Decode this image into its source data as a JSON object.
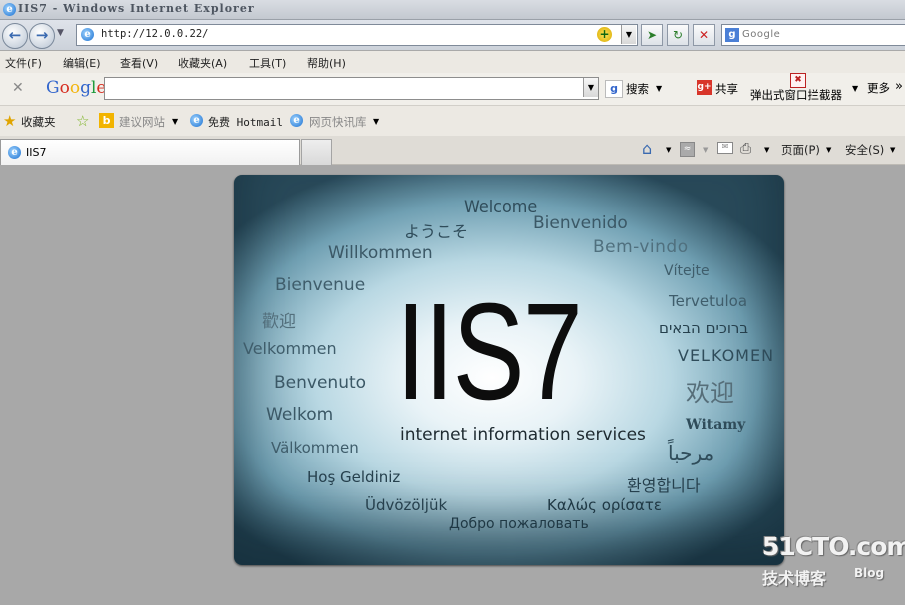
{
  "window": {
    "title": "IIS7 - Windows Internet Explorer"
  },
  "navbar": {
    "address": "http://12.0.0.22/",
    "search_placeholder": "Google"
  },
  "menu": {
    "items": [
      "文件(F)",
      "编辑(E)",
      "查看(V)",
      "收藏夹(A)",
      "工具(T)",
      "帮助(H)"
    ]
  },
  "google_toolbar": {
    "logo_text": "Google",
    "search_label": "搜索",
    "share_label": "共享",
    "popup_blocker_label": "弹出式窗口拦截器",
    "more_label": "更多",
    "more_chevron": "»"
  },
  "favorites_bar": {
    "favorites_label": "收藏夹",
    "suggested_sites": "建议网站",
    "free_hotmail": "免费 Hotmail",
    "web_slice_gallery": "网页快讯库"
  },
  "tab": {
    "title": "IIS7"
  },
  "command_bar": {
    "page_label": "页面(P)",
    "safety_label": "安全(S)"
  },
  "iis_page": {
    "logo": "IIS7",
    "subtitle": "internet information services",
    "greetings": [
      "Welcome",
      "ようこそ",
      "Bienvenido",
      "Willkommen",
      "Bem-vindo",
      "Vítejte",
      "Bienvenue",
      "Tervetuloa",
      "歡迎",
      "ברוכים הבאים",
      "Velkommen",
      "VELKOMEN",
      "欢迎",
      "Benvenuto",
      "Welkom",
      "Witamy",
      "Välkommen",
      "مرحباً",
      "Hoş Geldiniz",
      "환영합니다",
      "Üdvözöljük",
      "Καλώς ορίσατε",
      "Добро пожаловать"
    ]
  },
  "watermark": {
    "main": "51CTO.com",
    "sub": "技术博客",
    "blog": "Blog"
  }
}
